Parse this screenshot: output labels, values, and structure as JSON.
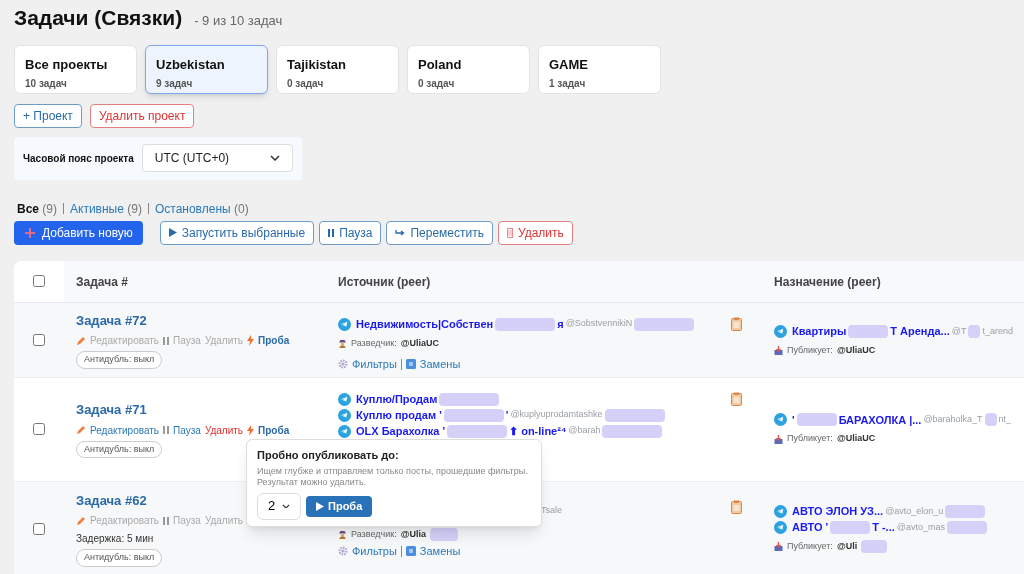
{
  "title": "Задачи (Связки)",
  "subtitle": "- 9 из 10 задач",
  "projects": [
    {
      "name": "Все проекты",
      "count": "10 задач",
      "selected": false
    },
    {
      "name": "Uzbekistan",
      "count": "9 задач",
      "selected": true
    },
    {
      "name": "Tajikistan",
      "count": "0 задач",
      "selected": false
    },
    {
      "name": "Poland",
      "count": "0 задач",
      "selected": false
    },
    {
      "name": "GAME",
      "count": "1 задач",
      "selected": false
    }
  ],
  "project_buttons": [
    {
      "label": "+ Проект",
      "kind": "primary"
    },
    {
      "label": "Удалить проект",
      "kind": "danger"
    }
  ],
  "timezone": {
    "label": "Часовой пояс проекта",
    "value": "UTC (UTC+0)"
  },
  "filters": [
    {
      "label": "Все",
      "count": "(9)",
      "selected": true
    },
    {
      "label": "Активные",
      "count": "(9)",
      "selected": false
    },
    {
      "label": "Остановлены",
      "count": "(0)",
      "selected": false
    }
  ],
  "add_button": "Добавить новую",
  "actions": [
    {
      "label": "Запустить выбранные",
      "kind": "play"
    },
    {
      "label": "Пауза",
      "kind": "pause"
    },
    {
      "label": "Переместить",
      "kind": "move"
    },
    {
      "label": "Удалить",
      "kind": "delete"
    }
  ],
  "select_all": {
    "checked": false
  },
  "columns": [
    "Задача #",
    "Источник (peer)",
    "Назначение (peer)"
  ],
  "rows": [
    {
      "title": "Задача #72",
      "checked": false,
      "active": false,
      "edit": "Редактировать",
      "pause": "Пауза",
      "delete": "Удалить",
      "probe": "Проба",
      "antidup": "Антидубль: выкл",
      "sources": [
        [
          {
            "kind": "name",
            "text": "Недвижимость|Собствен"
          },
          {
            "kind": "blur"
          },
          {
            "kind": "name",
            "text": "я"
          },
          {
            "kind": "handle",
            "text": "@SobstvennikiN"
          },
          {
            "kind": "blur"
          }
        ]
      ],
      "scout": {
        "label": "Разведчик:",
        "user": "@UliaUC"
      },
      "filters": "Фильтры",
      "replacements": "Замены",
      "targets": [
        [
          {
            "kind": "name",
            "text": "Квартиры"
          },
          {
            "kind": "blur"
          },
          {
            "kind": "name",
            "text": "Т Аренда..."
          },
          {
            "kind": "handle",
            "text": "@T"
          },
          {
            "kind": "blur"
          },
          {
            "kind": "handle",
            "text": "t_arend"
          }
        ]
      ],
      "publisher": {
        "label": "Публикует:",
        "user": "@UliaUC"
      }
    },
    {
      "title": "Задача #71",
      "checked": false,
      "active": true,
      "edit": "Редактировать",
      "pause": "Пауза",
      "delete": "Удалить",
      "probe": "Проба",
      "antidup": "Антидубль: выкл",
      "sources": [
        [
          {
            "kind": "name",
            "text": "Куплю/Продам"
          },
          {
            "kind": "blur"
          }
        ],
        [
          {
            "kind": "name",
            "text": "Куплю продам '"
          },
          {
            "kind": "blur"
          },
          {
            "kind": "name",
            "text": "'"
          },
          {
            "kind": "handle",
            "text": "@kuplyuprodamtashke"
          },
          {
            "kind": "blur"
          }
        ],
        [
          {
            "kind": "name",
            "text": "OLX Барахолка '"
          },
          {
            "kind": "blur"
          },
          {
            "kind": "name",
            "text": "⬆ on-line²⁴"
          },
          {
            "kind": "handle",
            "text": "@barah"
          },
          {
            "kind": "blur"
          }
        ]
      ],
      "targets": [
        [
          {
            "kind": "name",
            "text": "'"
          },
          {
            "kind": "blur"
          },
          {
            "kind": "name",
            "text": "БАРАХОЛКА |..."
          },
          {
            "kind": "handle",
            "text": "@baraholka_T"
          },
          {
            "kind": "blur"
          },
          {
            "kind": "handle",
            "text": "nt_"
          }
        ]
      ],
      "publisher": {
        "label": "Публикует:",
        "user": "@UliaUC"
      }
    },
    {
      "title": "Задача #62",
      "checked": false,
      "active": false,
      "edit": "Редактировать",
      "pause": "Пауза",
      "delete": "Удалить",
      "delay": "Задержка: 5 мин",
      "antidup": "Антидубль: выкл",
      "sources": [
        [
          {
            "kind": "handle",
            "text": "Tsale"
          }
        ]
      ],
      "scout": {
        "label": "Разведчик:",
        "user": "@Ulia"
      },
      "filters": "Фильтры",
      "replacements": "Замены",
      "targets": [
        [
          {
            "kind": "name",
            "text": "АВТО ЭЛОН УЗ..."
          },
          {
            "kind": "handle",
            "text": "@avto_elon_u"
          },
          {
            "kind": "blur"
          }
        ],
        [
          {
            "kind": "name",
            "text": "АВТО '"
          },
          {
            "kind": "blur"
          },
          {
            "kind": "name",
            "text": "Т -..."
          },
          {
            "kind": "handle",
            "text": "@avto_mas"
          },
          {
            "kind": "blur"
          }
        ]
      ],
      "publisher": {
        "label": "Публикует:",
        "user": "@Uli"
      }
    }
  ],
  "popover": {
    "title": "Пробно опубликовать до:",
    "text": "Ищем глубже и отправляем только посты, прошедшие фильтры. Результат можно удалить.",
    "value": "2",
    "button": "Проба"
  }
}
